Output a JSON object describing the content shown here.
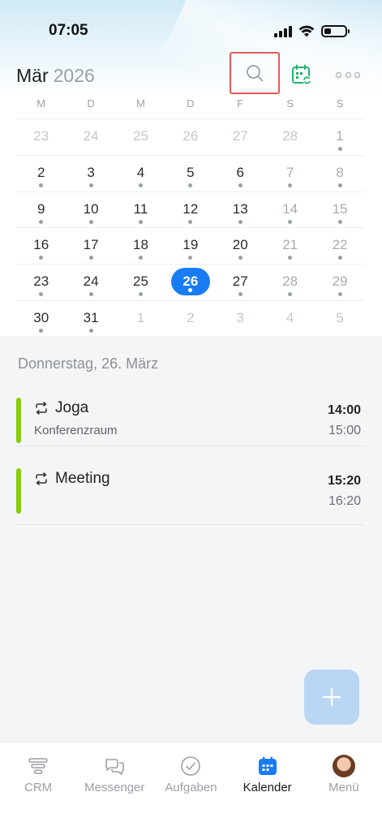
{
  "status_bar": {
    "time": "07:05"
  },
  "header": {
    "month": "Mär",
    "year": "2026",
    "search_icon": "search-icon",
    "calendar_sync_icon": "calendar-sync-icon",
    "more_icon": "more-icon"
  },
  "weekdays": [
    "M",
    "D",
    "M",
    "D",
    "F",
    "S",
    "S"
  ],
  "weeks": [
    [
      {
        "d": "23",
        "muted": true
      },
      {
        "d": "24",
        "muted": true
      },
      {
        "d": "25",
        "muted": true
      },
      {
        "d": "26",
        "muted": true
      },
      {
        "d": "27",
        "muted": true
      },
      {
        "d": "28",
        "muted": true
      },
      {
        "d": "1",
        "dot": true
      }
    ],
    [
      {
        "d": "2",
        "dot": true
      },
      {
        "d": "3",
        "dot": true
      },
      {
        "d": "4",
        "dot": true
      },
      {
        "d": "5",
        "dot": true
      },
      {
        "d": "6",
        "dot": true
      },
      {
        "d": "7",
        "dot": true
      },
      {
        "d": "8",
        "dot": true
      }
    ],
    [
      {
        "d": "9",
        "dot": true
      },
      {
        "d": "10",
        "dot": true
      },
      {
        "d": "11",
        "dot": true
      },
      {
        "d": "12",
        "dot": true
      },
      {
        "d": "13",
        "dot": true
      },
      {
        "d": "14",
        "dot": true
      },
      {
        "d": "15",
        "dot": true
      }
    ],
    [
      {
        "d": "16",
        "dot": true
      },
      {
        "d": "17",
        "dot": true
      },
      {
        "d": "18",
        "dot": true
      },
      {
        "d": "19",
        "dot": true
      },
      {
        "d": "20",
        "dot": true
      },
      {
        "d": "21",
        "dot": true
      },
      {
        "d": "22",
        "dot": true
      }
    ],
    [
      {
        "d": "23",
        "dot": true
      },
      {
        "d": "24",
        "dot": true
      },
      {
        "d": "25",
        "dot": true
      },
      {
        "d": "26",
        "dot": true,
        "today": true
      },
      {
        "d": "27",
        "dot": true
      },
      {
        "d": "28",
        "dot": true
      },
      {
        "d": "29",
        "dot": true
      }
    ],
    [
      {
        "d": "30",
        "dot": true
      },
      {
        "d": "31",
        "dot": true
      },
      {
        "d": "1",
        "muted": true
      },
      {
        "d": "2",
        "muted": true
      },
      {
        "d": "3",
        "muted": true
      },
      {
        "d": "4",
        "muted": true
      },
      {
        "d": "5",
        "muted": true
      }
    ]
  ],
  "agenda": {
    "date_heading": "Donnerstag, 26. März",
    "events": [
      {
        "title": "Joga",
        "location": "Konferenzraum",
        "start": "14:00",
        "end": "15:00",
        "color": "#8acb0b",
        "icon": "repeat-icon"
      },
      {
        "title": "Meeting",
        "location": "",
        "start": "15:20",
        "end": "16:20",
        "color": "#8acb0b",
        "icon": "repeat-icon"
      }
    ]
  },
  "fab": {
    "icon": "plus-icon"
  },
  "tabbar": [
    {
      "label": "CRM",
      "icon": "crm-funnel-icon",
      "active": false
    },
    {
      "label": "Messenger",
      "icon": "chat-bubbles-icon",
      "active": false
    },
    {
      "label": "Aufgaben",
      "icon": "check-circle-icon",
      "active": false
    },
    {
      "label": "Kalender",
      "icon": "calendar-icon",
      "active": true
    },
    {
      "label": "Menü",
      "icon": "avatar",
      "active": false
    }
  ],
  "colors": {
    "accent": "#1a7cf5",
    "event_bar": "#8acb0b",
    "fab": "#b9d6f5",
    "highlight_border": "#e05b5b"
  }
}
